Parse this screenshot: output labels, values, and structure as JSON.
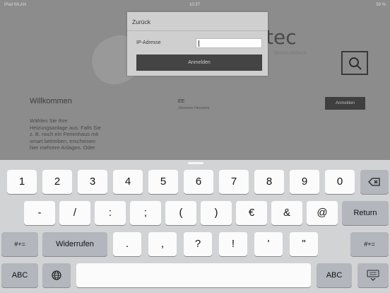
{
  "status_bar": {
    "carrier": "iPad WLAN",
    "time": "10:37",
    "battery": "59 %"
  },
  "background": {
    "logo_text": "tec",
    "logo_subtext": "heizen einfach",
    "welcome_title": "Willkommen",
    "welcome_body": "Wählen Sie Ihre\nHeizungsanlage aus. Falls Sie\nz. B. noch ein Ferienhaus mit\nsmart betreiben, erscheinen\nhier mehrere Anlagen. Oder",
    "device_name": "EE",
    "device_subtitle": "Johannes Herzwerk",
    "login_button": "Anmelden"
  },
  "dialog": {
    "back_label": "Zurück",
    "ip_label": "IP-Adresse",
    "ip_value": "",
    "login_button": "Anmelden"
  },
  "keyboard": {
    "row1": [
      "1",
      "2",
      "3",
      "4",
      "5",
      "6",
      "7",
      "8",
      "9",
      "0"
    ],
    "row2": [
      "-",
      "/",
      ":",
      ";",
      "(",
      ")",
      "€",
      "&",
      "@"
    ],
    "return_label": "Return",
    "symbols_toggle": "#+=",
    "undo_label": "Widerrufen",
    "row3": [
      ".",
      ",",
      "?",
      "!",
      "'",
      "\""
    ],
    "abc_label": "ABC",
    "hide_label": "dismiss"
  }
}
